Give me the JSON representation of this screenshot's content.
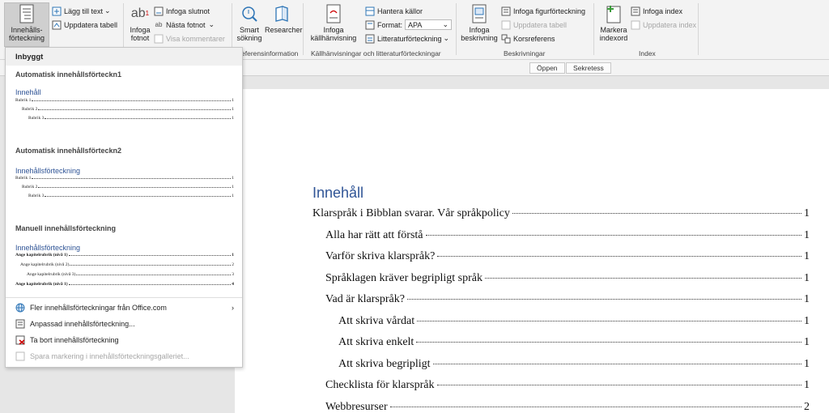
{
  "ribbon": {
    "toc_button": "Innehålls-\nförteckning",
    "add_text": "Lägg till text",
    "update_table": "Uppdatera tabell",
    "insert_footnote": "Infoga\nfotnot",
    "insert_endnote": "Infoga slutnot",
    "next_footnote": "Nästa fotnot",
    "show_notes": "Visa kommentarer",
    "smart_search": "Smart\nsökning",
    "researcher": "Researcher",
    "group_research": "eferensinformation",
    "insert_citation": "Infoga\nkällhänvisning",
    "manage_sources": "Hantera källor",
    "format_label": "Format:",
    "format_value": "APA",
    "bibliography": "Litteraturförteckning",
    "group_citations": "Källhänvisningar och litteraturförteckningar",
    "insert_caption": "Infoga\nbeskrivning",
    "insert_table_figures": "Infoga figurförteckning",
    "update_table2": "Uppdatera tabell",
    "cross_reference": "Korsreferens",
    "group_captions": "Beskrivningar",
    "mark_entry": "Markera\nindexord",
    "insert_index": "Infoga index",
    "update_index": "Uppdatera index",
    "group_index": "Index"
  },
  "strip": {
    "open": "Öppen",
    "privacy": "Sekretess"
  },
  "panel": {
    "header": "Inbyggt",
    "auto1_title": "Automatisk innehållsförteckn1",
    "auto1_heading": "Innehåll",
    "auto1_lines": [
      {
        "text": "Rubrik 1",
        "page": "1"
      },
      {
        "text": "Rubrik 2",
        "page": "1"
      },
      {
        "text": "Rubrik 3",
        "page": "1"
      }
    ],
    "auto2_title": "Automatisk innehållsförteckn2",
    "auto2_heading": "Innehållsförteckning",
    "auto2_lines": [
      {
        "text": "Rubrik 1",
        "page": "1"
      },
      {
        "text": "Rubrik 2",
        "page": "1"
      },
      {
        "text": "Rubrik 3",
        "page": "1"
      }
    ],
    "manual_title": "Manuell innehållsförteckning",
    "manual_heading": "Innehållsförteckning",
    "manual_lines": [
      {
        "text": "Ange kapitelrubrik (nivå 1)",
        "page": "1"
      },
      {
        "text": "Ange kapitelrubrik (nivå 2)",
        "page": "2"
      },
      {
        "text": "Ange kapitelrubrik (nivå 3)",
        "page": "3"
      },
      {
        "text": "Ange kapitelrubrik (nivå 1)",
        "page": "4"
      }
    ],
    "more_office": "Fler innehållsförteckningar från Office.com",
    "custom_toc": "Anpassad innehållsförteckning...",
    "remove_toc": "Ta bort innehållsförteckning",
    "save_selection": "Spara markering i innehållsförteckningsgalleriet..."
  },
  "document": {
    "title": "Innehåll",
    "entries": [
      {
        "text": "Klarspråk i Bibblan svarar. Vår språkpolicy",
        "page": "1"
      },
      {
        "text": "Alla har rätt att förstå",
        "page": "1"
      },
      {
        "text": "Varför skriva klarspråk?",
        "page": "1"
      },
      {
        "text": "Språklagen kräver begripligt språk",
        "page": "1"
      },
      {
        "text": "Vad är klarspråk?",
        "page": "1"
      },
      {
        "text": "Att skriva vårdat",
        "page": "1"
      },
      {
        "text": "Att skriva enkelt",
        "page": "1"
      },
      {
        "text": "Att skriva begripligt",
        "page": "1"
      },
      {
        "text": "Checklista för klarspråk",
        "page": "1"
      },
      {
        "text": "Webbresurser",
        "page": "2"
      }
    ]
  },
  "colors": {
    "heading_blue": "#2f5496",
    "ribbon_bg": "#f3f3f3",
    "doc_bg": "#e6e6e6"
  }
}
